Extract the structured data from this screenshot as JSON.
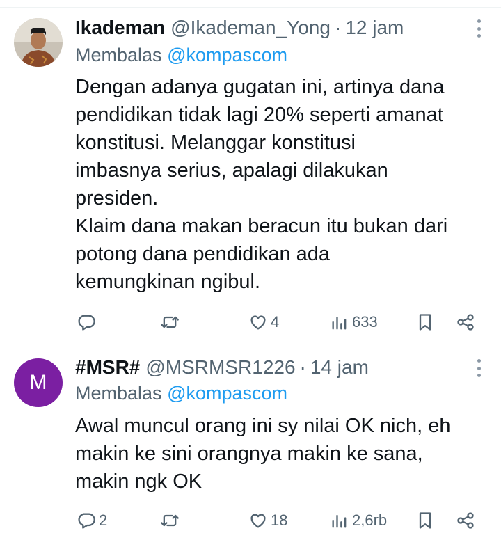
{
  "tweets": [
    {
      "display_name": "Ikademan",
      "handle": "@Ikademan_Yong",
      "separator": "·",
      "time": "12 jam",
      "avatar_icon": "person-photo-avatar",
      "reply_prefix": "Membalas",
      "reply_to": "@kompascom",
      "body_lines": [
        "Dengan adanya gugatan ini, artinya dana",
        "pendidikan tidak lagi 20% seperti amanat",
        "konstitusi. Melanggar konstitusi",
        "imbasnya serius, apalagi dilakukan",
        "presiden.",
        "Klaim dana makan beracun itu bukan dari",
        "potong dana pendidikan ada",
        "kemungkinan ngibul."
      ],
      "stats": {
        "replies": "",
        "retweets": "",
        "likes": "4",
        "views": "633"
      }
    },
    {
      "display_name": "#MSR#",
      "handle": "@MSRMSR1226",
      "separator": "·",
      "time": "14 jam",
      "avatar_letter": "M",
      "avatar_color": "#7b1fa2",
      "reply_prefix": "Membalas",
      "reply_to": "@kompascom",
      "body_lines": [
        "Awal muncul orang ini sy nilai OK nich, eh",
        "makin ke sini orangnya makin ke sana,",
        "makin ngk OK"
      ],
      "stats": {
        "replies": "2",
        "retweets": "",
        "likes": "18",
        "views": "2,6rb"
      }
    }
  ],
  "colors": {
    "text": "#0f1419",
    "secondary": "#536471",
    "link": "#1d9bf0",
    "divider": "#e4e8ea"
  }
}
